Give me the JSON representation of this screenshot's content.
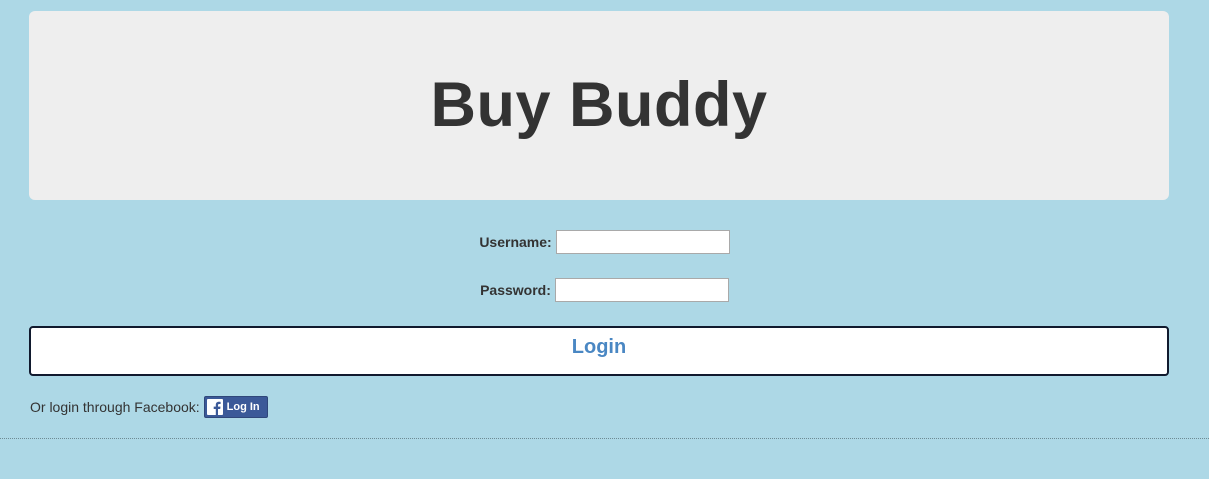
{
  "header": {
    "title": "Buy Buddy"
  },
  "form": {
    "username_label": "Username:",
    "username_value": "",
    "password_label": "Password:",
    "password_value": ""
  },
  "login_button": {
    "label": "Login"
  },
  "facebook": {
    "prompt": "Or login through Facebook:",
    "button_label": "Log In",
    "icon": "facebook-f-icon"
  },
  "colors": {
    "page_background": "#add8e6",
    "header_background": "#eeeeee",
    "login_text": "#4a87c3",
    "facebook_blue": "#3b5998"
  }
}
